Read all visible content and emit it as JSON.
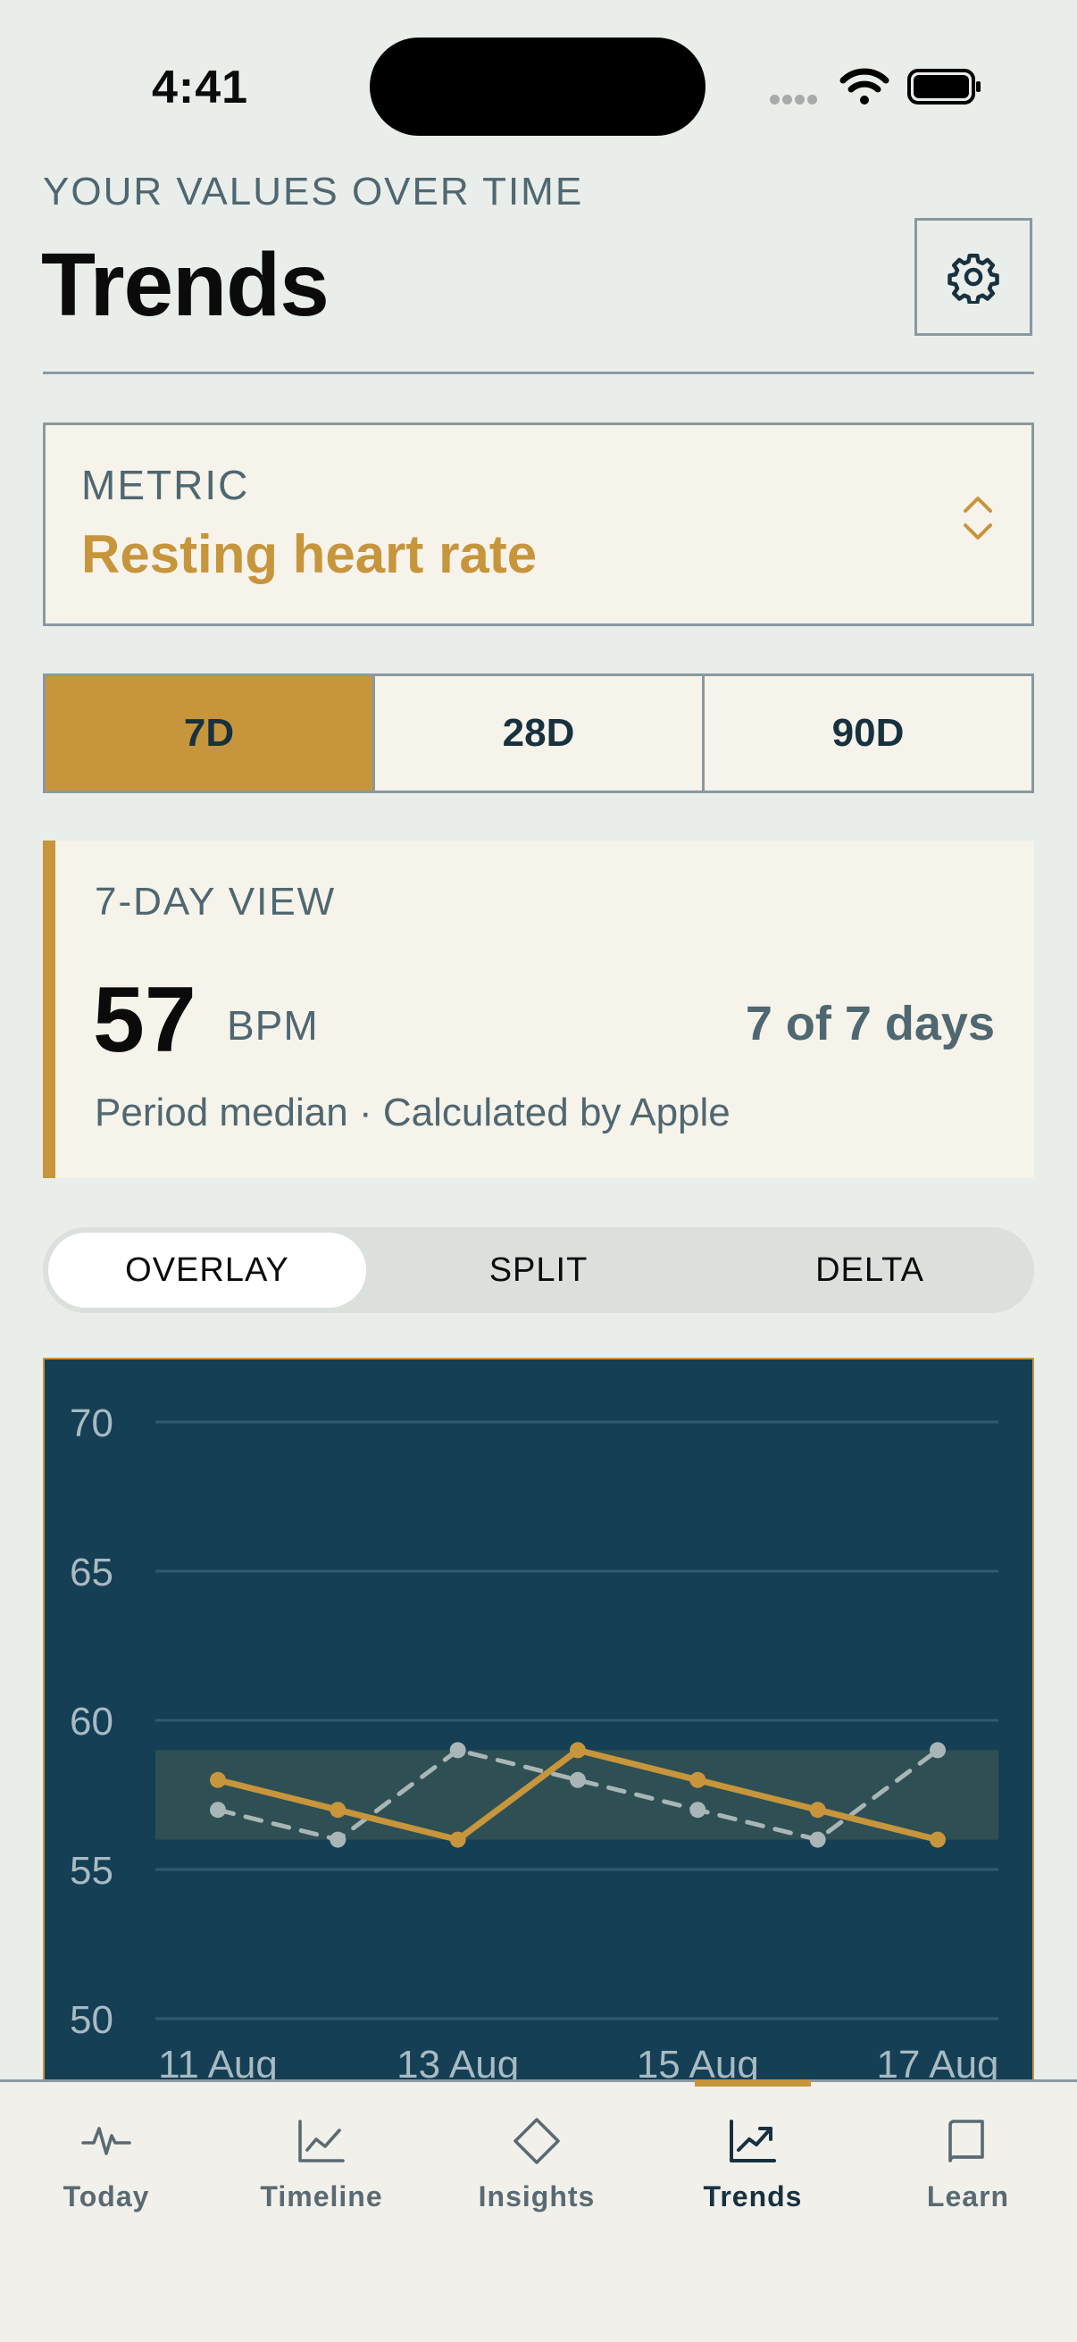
{
  "status": {
    "time": "4:41"
  },
  "header": {
    "eyebrow": "YOUR VALUES OVER TIME",
    "title": "Trends"
  },
  "metric": {
    "label": "METRIC",
    "value": "Resting heart rate"
  },
  "ranges": [
    {
      "label": "7D",
      "active": true
    },
    {
      "label": "28D",
      "active": false
    },
    {
      "label": "90D",
      "active": false
    }
  ],
  "summary": {
    "eyebrow": "7-DAY VIEW",
    "value": "57",
    "unit": "BPM",
    "coverage": "7 of 7 days",
    "note": "Period median · Calculated by Apple"
  },
  "view_modes": [
    {
      "label": "OVERLAY",
      "active": true
    },
    {
      "label": "SPLIT",
      "active": false
    },
    {
      "label": "DELTA",
      "active": false
    }
  ],
  "chart_data": {
    "type": "line",
    "x": [
      "11 Aug",
      "12 Aug",
      "13 Aug",
      "14 Aug",
      "15 Aug",
      "16 Aug",
      "17 Aug"
    ],
    "x_tick_labels": [
      "11 Aug",
      "13 Aug",
      "15 Aug",
      "17 Aug"
    ],
    "y_ticks": [
      70,
      65,
      60,
      55,
      50
    ],
    "ylim": [
      50,
      70
    ],
    "band": [
      56,
      59
    ],
    "series": [
      {
        "values": [
          58,
          57,
          56,
          59,
          58,
          57,
          56
        ],
        "color": "#C7953C",
        "style": "solid"
      },
      {
        "values": [
          57,
          56,
          59,
          58,
          57,
          56,
          59
        ],
        "color": "#A9B5B6",
        "style": "dashed"
      }
    ],
    "grid": true
  },
  "tabs": [
    {
      "label": "Today",
      "icon": "pulse-icon",
      "active": false
    },
    {
      "label": "Timeline",
      "icon": "line-chart-icon",
      "active": false
    },
    {
      "label": "Insights",
      "icon": "diamond-icon",
      "active": false
    },
    {
      "label": "Trends",
      "icon": "trend-up-icon",
      "active": true
    },
    {
      "label": "Learn",
      "icon": "book-icon",
      "active": false
    }
  ],
  "colors": {
    "accent": "#C7953C",
    "chart_bg": "#143F54",
    "ink": "#17313F"
  }
}
